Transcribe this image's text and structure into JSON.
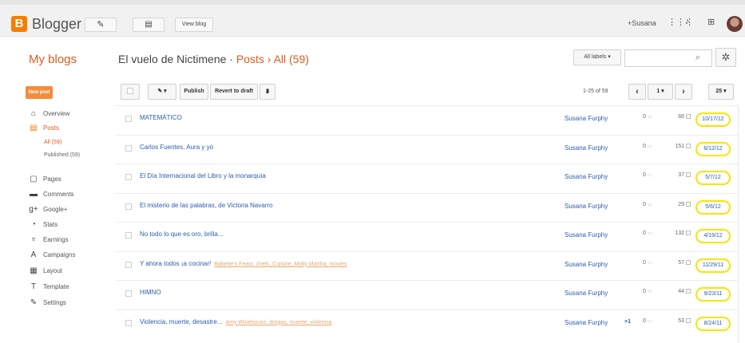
{
  "app": {
    "logo_letter": "B",
    "brand": "Blogger",
    "view_blog_label": "View blog",
    "user": "+Susana"
  },
  "header": {
    "my_blogs": "My blogs",
    "blog_name": "El vuelo de Nictimene",
    "sep1": "·",
    "posts": "Posts",
    "sep2": "›",
    "all_count": "All (59)",
    "labels_select": "All labels ▾",
    "search_value": ""
  },
  "sidebar": {
    "new_post": "New post",
    "items": [
      {
        "icon": "home-icon",
        "glyph": "⌂",
        "label": "Overview"
      },
      {
        "icon": "posts-icon",
        "glyph": "▤",
        "label": "Posts",
        "active": true
      },
      {
        "icon": "pages-icon",
        "glyph": "▢",
        "label": "Pages"
      },
      {
        "icon": "comments-icon",
        "glyph": "▬",
        "label": "Comments"
      },
      {
        "icon": "google-plus-icon",
        "glyph": "g+",
        "label": "Google+"
      },
      {
        "icon": "stats-icon",
        "glyph": "◔",
        "label": "Stats"
      },
      {
        "icon": "earnings-icon",
        "glyph": "♆",
        "label": "Earnings"
      },
      {
        "icon": "campaigns-icon",
        "glyph": "A",
        "label": "Campaigns"
      },
      {
        "icon": "layout-icon",
        "glyph": "▦",
        "label": "Layout"
      },
      {
        "icon": "template-icon",
        "glyph": "T",
        "label": "Template"
      },
      {
        "icon": "settings-icon",
        "glyph": "✎",
        "label": "Settings"
      }
    ],
    "sub_all": "All (59)",
    "sub_published": "Published (59)"
  },
  "toolbar": {
    "label_dropdown": "✎ ▾",
    "publish": "Publish",
    "revert": "Revert to draft",
    "delete_glyph": "▮",
    "range": "1-25 of 59",
    "prev": "‹",
    "page": "1 ▾",
    "next": "›",
    "per_page": "25 ▾"
  },
  "posts": [
    {
      "title": "MATEMÁTICO",
      "labels": "",
      "author": "Susana Furphy",
      "share": "",
      "comments": "0",
      "views": "66",
      "date": "10/17/12"
    },
    {
      "title": "Carlos Fuentes, Aura y yo",
      "labels": "",
      "author": "Susana Furphy",
      "share": "",
      "comments": "0",
      "views": "151",
      "date": "6/12/12"
    },
    {
      "title": "El Día Internacional del Libro y la monarquía",
      "labels": "",
      "author": "Susana Furphy",
      "share": "",
      "comments": "0",
      "views": "37",
      "date": "5/7/12"
    },
    {
      "title": "El misterio de las palabras, de Victoria Navarro",
      "labels": "",
      "author": "Susana Furphy",
      "share": "",
      "comments": "0",
      "views": "29",
      "date": "5/6/12"
    },
    {
      "title": "No todo lo que es oro, brilla...",
      "labels": "",
      "author": "Susana Furphy",
      "share": "",
      "comments": "0",
      "views": "132",
      "date": "4/19/12"
    },
    {
      "title": "Y ahora todos ¡a cocinar!",
      "labels": "Babette's Feast, chefs, Cuisine, Molly Martha, movies",
      "author": "Susana Furphy",
      "share": "",
      "comments": "0",
      "views": "57",
      "date": "11/29/11"
    },
    {
      "title": "HIMNO",
      "labels": "",
      "author": "Susana Furphy",
      "share": "",
      "comments": "0",
      "views": "44",
      "date": "9/23/11"
    },
    {
      "title": "Violencia, muerte, desastre...",
      "labels": "Amy Winehouse, drogas, muerte, violencia",
      "author": "Susana Furphy",
      "share": "+1",
      "comments": "0",
      "views": "53",
      "date": "8/24/11"
    }
  ],
  "colors": {
    "accent": "#f57d00",
    "link": "#2a5db0",
    "highlight": "#f5e600"
  }
}
